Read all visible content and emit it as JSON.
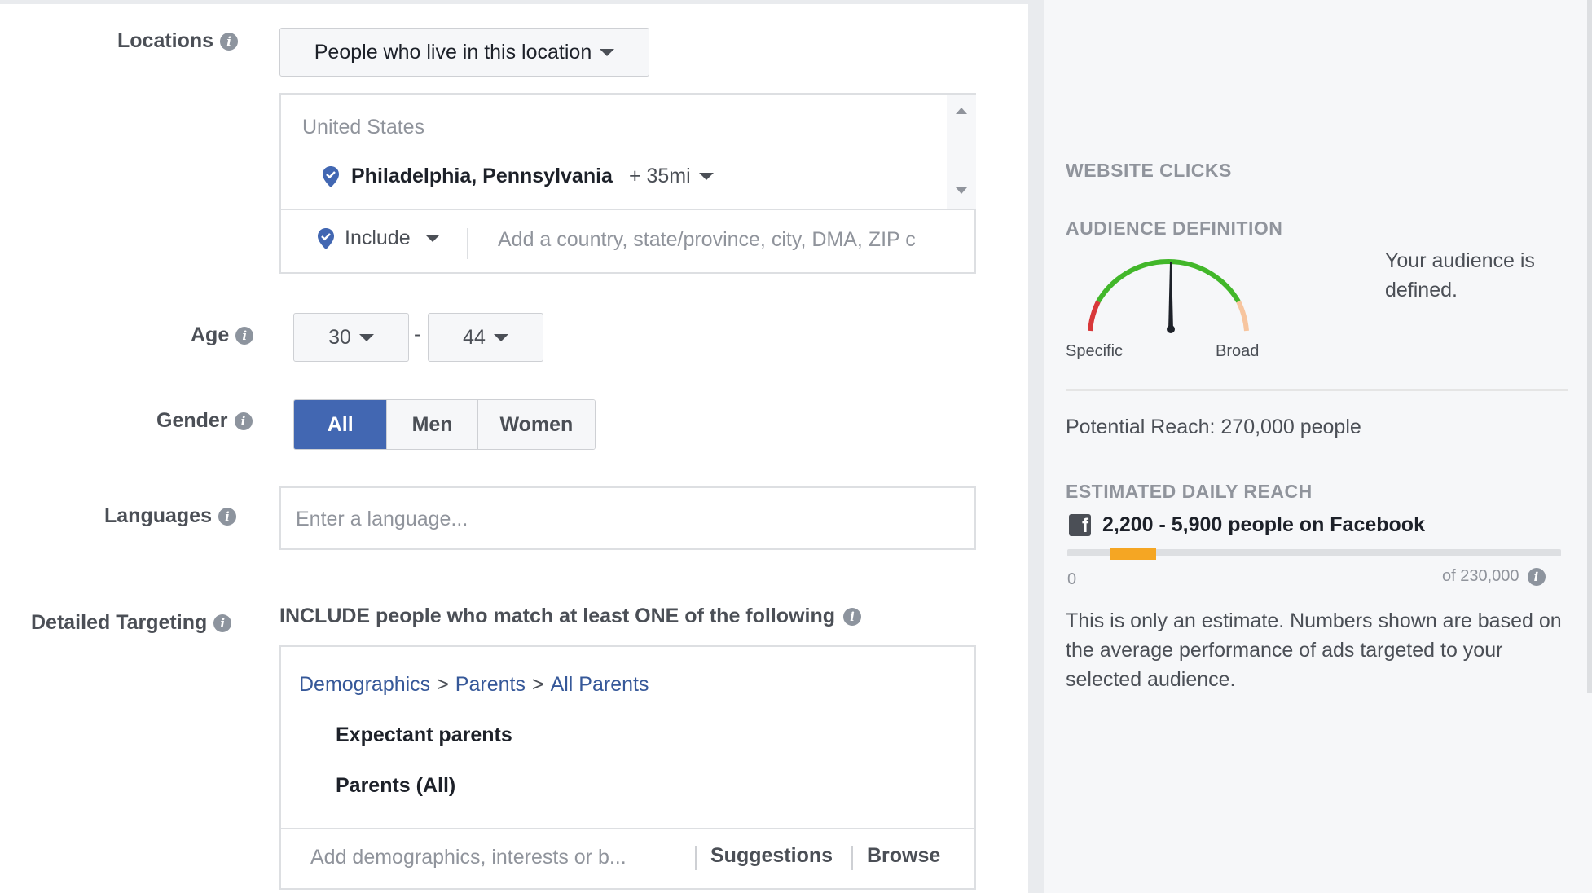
{
  "form": {
    "locations": {
      "label": "Locations",
      "dropdown_value": "People who live in this location",
      "country": "United States",
      "city": "Philadelphia, Pennsylvania",
      "radius": "+ 35mi",
      "include_label": "Include",
      "search_placeholder": "Add a country, state/province, city, DMA, ZIP c"
    },
    "age": {
      "label": "Age",
      "min": "30",
      "separator": "-",
      "max": "44"
    },
    "gender": {
      "label": "Gender",
      "options": [
        "All",
        "Men",
        "Women"
      ],
      "selected": "All"
    },
    "languages": {
      "label": "Languages",
      "placeholder": "Enter a language..."
    },
    "detailed_targeting": {
      "label": "Detailed Targeting",
      "instruction": "INCLUDE people who match at least ONE of the following",
      "breadcrumb": [
        "Demographics",
        "Parents",
        "All Parents"
      ],
      "breadcrumb_sep": ">",
      "items": [
        "Expectant parents",
        "Parents (All)"
      ],
      "search_placeholder": "Add demographics, interests or b...",
      "suggestions_label": "Suggestions",
      "browse_label": "Browse"
    }
  },
  "sidebar": {
    "objective": "WEBSITE CLICKS",
    "audience_title": "AUDIENCE DEFINITION",
    "gauge_specific": "Specific",
    "gauge_broad": "Broad",
    "gauge_level": 0.5,
    "audience_status": "Your audience is defined.",
    "potential_reach": "Potential Reach: 270,000 people",
    "daily_reach_title": "ESTIMATED DAILY REACH",
    "daily_reach_value": "2,200 - 5,900 people on Facebook",
    "reach_bar_start": 2200,
    "reach_bar_end": 5900,
    "reach_min": "0",
    "reach_max": "of 230,000",
    "reach_max_value": 230000,
    "disclaimer": "This is only an estimate. Numbers shown are based on the average performance of ads targeted to your selected audience.",
    "colors": {
      "gauge_green": "#42b72a",
      "gauge_red": "#d8383a",
      "gauge_peach": "#f7c59f",
      "reach_orange": "#f5a623",
      "accent_blue": "#4267b2"
    }
  }
}
